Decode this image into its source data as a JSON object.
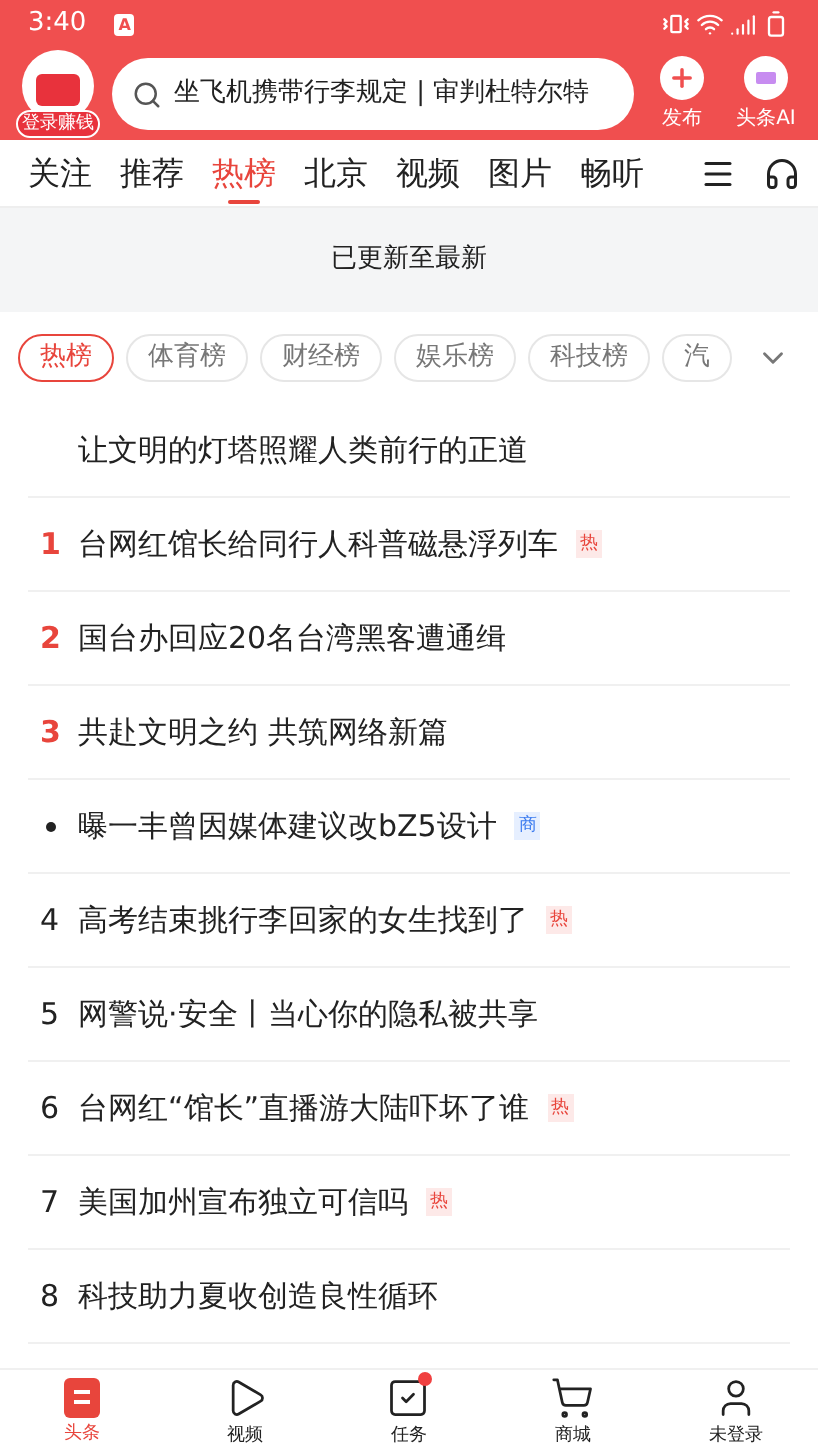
{
  "status_bar": {
    "time": "3:40",
    "badge": "A"
  },
  "header": {
    "login_label": "登录赚钱",
    "search": {
      "placeholder": "坐飞机携带行李规定 | 审判杜特尔特"
    },
    "actions": [
      {
        "label": "发布",
        "kind": "plus"
      },
      {
        "label": "头条AI",
        "kind": "ai"
      }
    ]
  },
  "tabs": [
    {
      "label": "关注",
      "selected": false
    },
    {
      "label": "推荐",
      "selected": false
    },
    {
      "label": "热榜",
      "selected": true
    },
    {
      "label": "北京",
      "selected": false
    },
    {
      "label": "视频",
      "selected": false
    },
    {
      "label": "图片",
      "selected": false
    },
    {
      "label": "畅听",
      "selected": false
    }
  ],
  "refresh_notice": "已更新至最新",
  "chips": [
    {
      "label": "热榜",
      "selected": true
    },
    {
      "label": "体育榜",
      "selected": false
    },
    {
      "label": "财经榜",
      "selected": false
    },
    {
      "label": "娱乐榜",
      "selected": false
    },
    {
      "label": "科技榜",
      "selected": false
    },
    {
      "label": "汽",
      "selected": false
    }
  ],
  "items": [
    {
      "kind": "pinned",
      "title": "让文明的灯塔照耀人类前行的正道"
    },
    {
      "kind": "top",
      "rank": "1",
      "title": "台网红馆长给同行人科普磁悬浮列车",
      "tag": {
        "label": "热",
        "kind": "hot"
      }
    },
    {
      "kind": "top",
      "rank": "2",
      "title": "国台办回应20名台湾黑客遭通缉"
    },
    {
      "kind": "top",
      "rank": "3",
      "title": "共赴文明之约 共筑网络新篇"
    },
    {
      "kind": "ad",
      "title": "曝一丰曾因媒体建议改bZ5设计",
      "tag": {
        "label": "商",
        "kind": "ad"
      }
    },
    {
      "kind": "plain",
      "rank": "4",
      "title": "高考结束挑行李回家的女生找到了",
      "tag": {
        "label": "热",
        "kind": "hot"
      }
    },
    {
      "kind": "plain",
      "rank": "5",
      "title": "网警说·安全丨当心你的隐私被共享"
    },
    {
      "kind": "plain",
      "rank": "6",
      "title": "台网红“馆长”直播游大陆吓坏了谁",
      "tag": {
        "label": "热",
        "kind": "hot"
      }
    },
    {
      "kind": "plain",
      "rank": "7",
      "title": "美国加州宣布独立可信吗",
      "tag": {
        "label": "热",
        "kind": "hot"
      }
    },
    {
      "kind": "plain",
      "rank": "8",
      "title": "科技助力夏收创造良性循环"
    }
  ],
  "bottom_nav": [
    {
      "label": "头条",
      "kind": "home",
      "selected": true,
      "dot": false
    },
    {
      "label": "视频",
      "kind": "video",
      "selected": false,
      "dot": false
    },
    {
      "label": "任务",
      "kind": "task",
      "selected": false,
      "dot": true
    },
    {
      "label": "商城",
      "kind": "cart",
      "selected": false,
      "dot": false
    },
    {
      "label": "未登录",
      "kind": "user",
      "selected": false,
      "dot": false
    }
  ]
}
